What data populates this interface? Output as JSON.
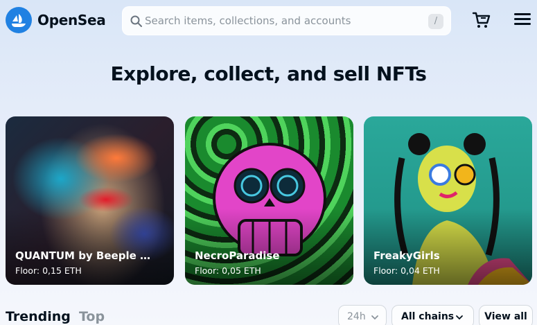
{
  "header": {
    "brand": "OpenSea",
    "search_placeholder": "Search items, collections, and accounts",
    "search_shortcut": "/"
  },
  "hero": {
    "title": "Explore, collect, and sell NFTs"
  },
  "cards": [
    {
      "name": "QUANTUM by Beeple My...",
      "floor": "Floor: 0,15 ETH"
    },
    {
      "name": "NecroParadise",
      "floor": "Floor: 0,05 ETH"
    },
    {
      "name": "FreakyGirls",
      "floor": "Floor: 0,04 ETH"
    }
  ],
  "tabs": {
    "trending": "Trending",
    "top": "Top"
  },
  "filters": {
    "time": "24h",
    "chains": "All chains",
    "view_all": "View all"
  },
  "colors": {
    "accent": "#2081e2",
    "text": "#04111d",
    "muted": "#8a939b"
  },
  "icons": [
    "opensea-logo-icon",
    "search-icon",
    "cart-icon",
    "menu-icon",
    "chevron-down-icon"
  ]
}
